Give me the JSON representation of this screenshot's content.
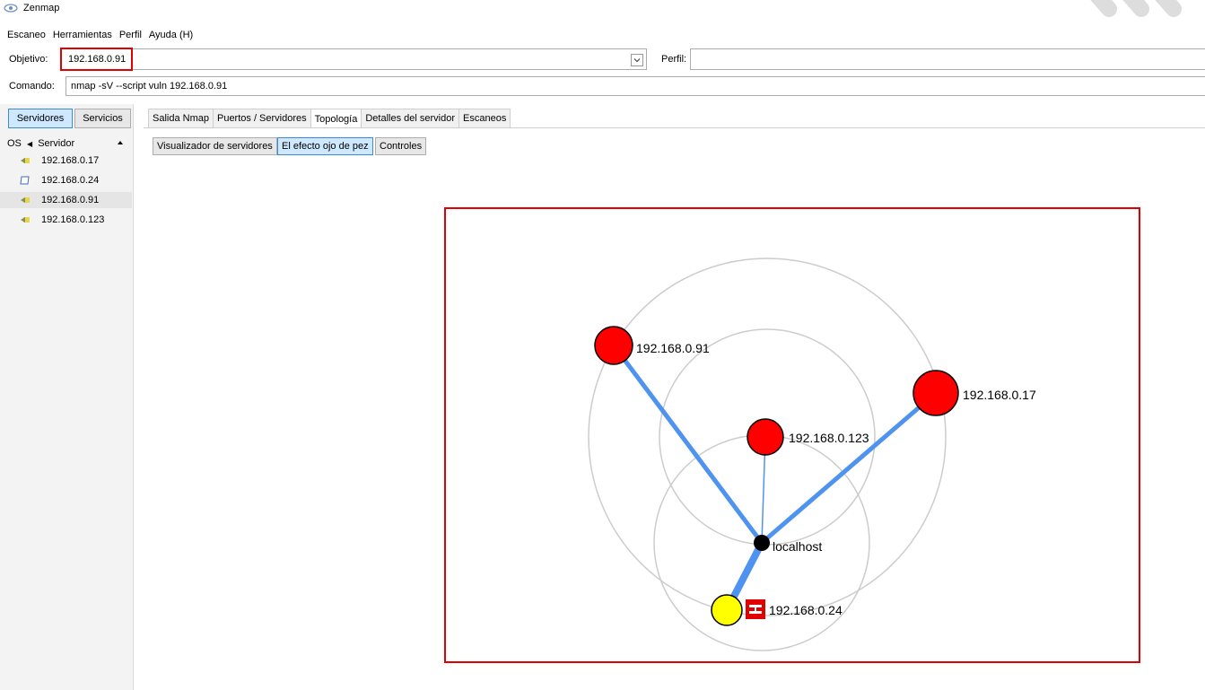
{
  "window": {
    "title": "Zenmap"
  },
  "menu": [
    "Escaneo",
    "Herramientas",
    "Perfil",
    "Ayuda (H)"
  ],
  "target": {
    "label": "Objetivo:",
    "value": "192.168.0.91"
  },
  "profile": {
    "label": "Perfil:",
    "value": ""
  },
  "command": {
    "label": "Comando:",
    "value": "nmap -sV --script vuln 192.168.0.91"
  },
  "left_tabs": {
    "hosts": "Servidores",
    "services": "Servicios"
  },
  "host_list": {
    "col_os": "OS",
    "col_host": "Servidor",
    "hosts": [
      "192.168.0.17",
      "192.168.0.24",
      "192.168.0.91",
      "192.168.0.123"
    ],
    "selected": "192.168.0.91"
  },
  "tabs": [
    "Salida Nmap",
    "Puertos / Servidores",
    "Topología",
    "Detalles del servidor",
    "Escaneos"
  ],
  "active_tab": "Topología",
  "topology_buttons": [
    "Visualizador de servidores",
    "El efecto ojo de pez",
    "Controles"
  ],
  "topology": {
    "center": "localhost",
    "nodes": [
      "192.168.0.91",
      "192.168.0.17",
      "192.168.0.123",
      "192.168.0.24"
    ]
  },
  "colors": {
    "red_node": "#ff0000",
    "yellow_node": "#ffff00",
    "edge": "#4f93f0",
    "highlight": "#e00000"
  }
}
